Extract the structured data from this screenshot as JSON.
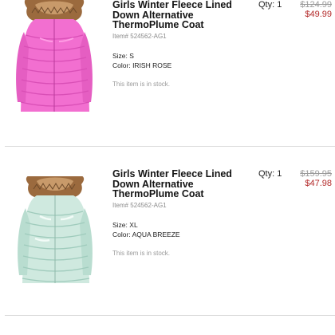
{
  "items": [
    {
      "title": "Girls Winter Fleece Lined Down Alternative ThermoPlume Coat",
      "qty_label": "Qty:",
      "qty": "1",
      "original_price": "$124.99",
      "sale_price": "$49.99",
      "sku_label": "Item#",
      "sku": "524562-AG1",
      "size_label": "Size:",
      "size": "S",
      "color_label": "Color:",
      "color": "IRISH ROSE",
      "stock_status": "This item is in stock.",
      "coat_color": "#f26fd0"
    },
    {
      "title": "Girls Winter Fleece Lined Down Alternative ThermoPlume Coat",
      "qty_label": "Qty:",
      "qty": "1",
      "original_price": "$159.95",
      "sale_price": "$47.98",
      "sku_label": "Item#",
      "sku": "524562-AG1",
      "size_label": "Size:",
      "size": "XL",
      "color_label": "Color:",
      "color": "AQUA BREEZE",
      "stock_status": "This item is in stock.",
      "coat_color": "#cfe9df"
    }
  ],
  "colors": {
    "sale_price": "#b32a2a",
    "original_price": "#9a9a9a",
    "divider": "#dcdcdc"
  }
}
